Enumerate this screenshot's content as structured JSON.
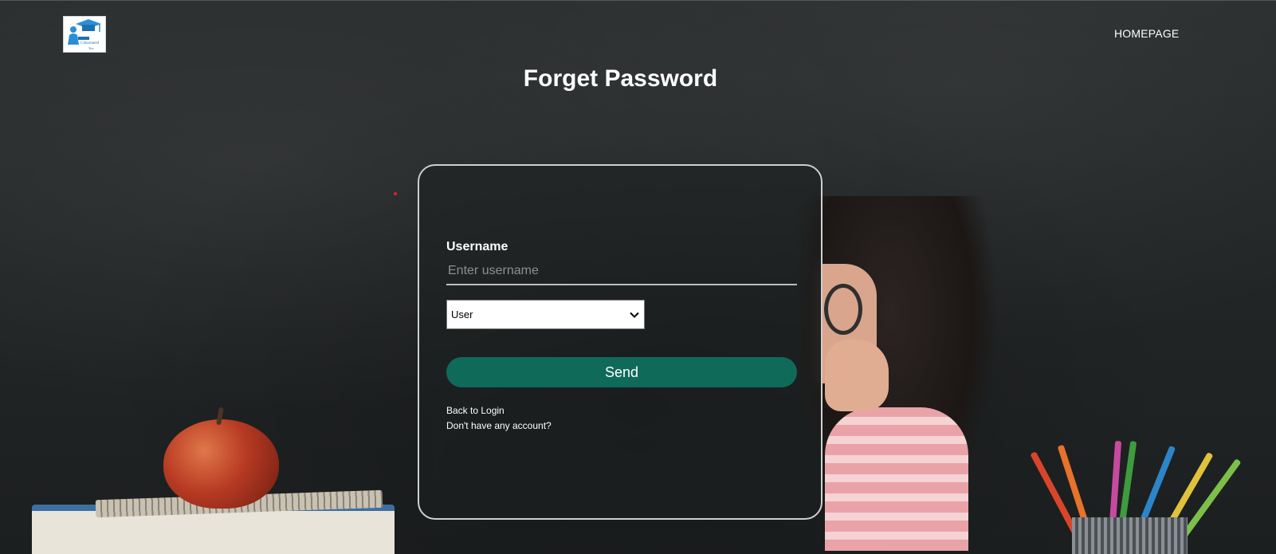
{
  "header": {
    "logo_text": "Classmate4\nYou",
    "nav_homepage": "HOMEPAGE"
  },
  "page": {
    "title": "Forget Password"
  },
  "form": {
    "username_label": "Username",
    "username_value": "",
    "username_placeholder": "Enter username",
    "role_select": {
      "selected": "User"
    },
    "send_label": "Send",
    "back_to_login": "Back to Login",
    "no_account": "Don't have any account?"
  },
  "colors": {
    "background": "#232627",
    "send_button": "#0f6a5a",
    "card_border": "#cfcfcf",
    "logo_accent": "#2c8fd6"
  }
}
